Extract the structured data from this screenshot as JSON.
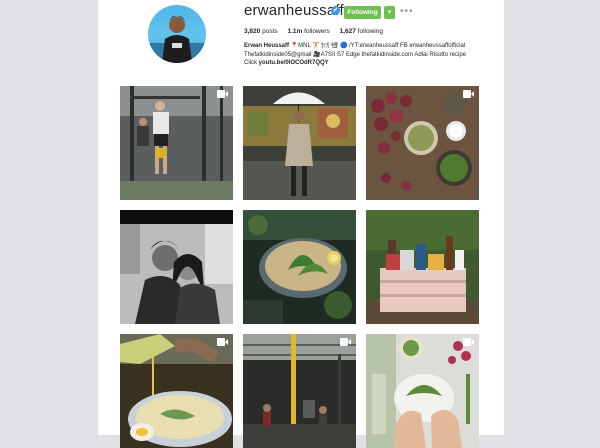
{
  "profile": {
    "username": "erwanheussaff",
    "verified_glyph": "✔",
    "follow_label": "Following",
    "dropdown_glyph": "▾",
    "more_glyph": "•••",
    "avatar_icon": "profile-photo"
  },
  "stats": {
    "posts_count": "3,820",
    "posts_label": "posts",
    "followers_count": "1.1m",
    "followers_label": "followers",
    "following_count": "1,627",
    "following_label": "following"
  },
  "bio": {
    "line1_name": "Erwan Heussaff",
    "line1_rest": " 📍MNL 🏋 🍽 📽 🔵 /YT:erwanheussaff FB erwanheussaffofficial",
    "line2": "Thefatkidinside05@gmail 🎥A7SII S7 Edge thefatkidinside.com Adlai Risotto recipe",
    "line3_prefix": "Click ",
    "line3_link": "youtu.be/0lOCOdR7QQY"
  },
  "posts": [
    {
      "name": "crossfit-gym",
      "video": true
    },
    {
      "name": "umbrella-man-mural",
      "video": false
    },
    {
      "name": "onions-herbs-bowls",
      "video": true
    },
    {
      "name": "couple-bw-photo",
      "video": false
    },
    {
      "name": "herb-soup-bowl",
      "video": false
    },
    {
      "name": "wooden-crate-groceries",
      "video": false
    },
    {
      "name": "oil-pour-bowl",
      "video": true
    },
    {
      "name": "warehouse-workout",
      "video": true
    },
    {
      "name": "hands-plating-salad",
      "video": true
    }
  ],
  "colors": {
    "follow_green": "#70c050",
    "verified_blue": "#3897f0",
    "background": "#dfe1e5"
  }
}
